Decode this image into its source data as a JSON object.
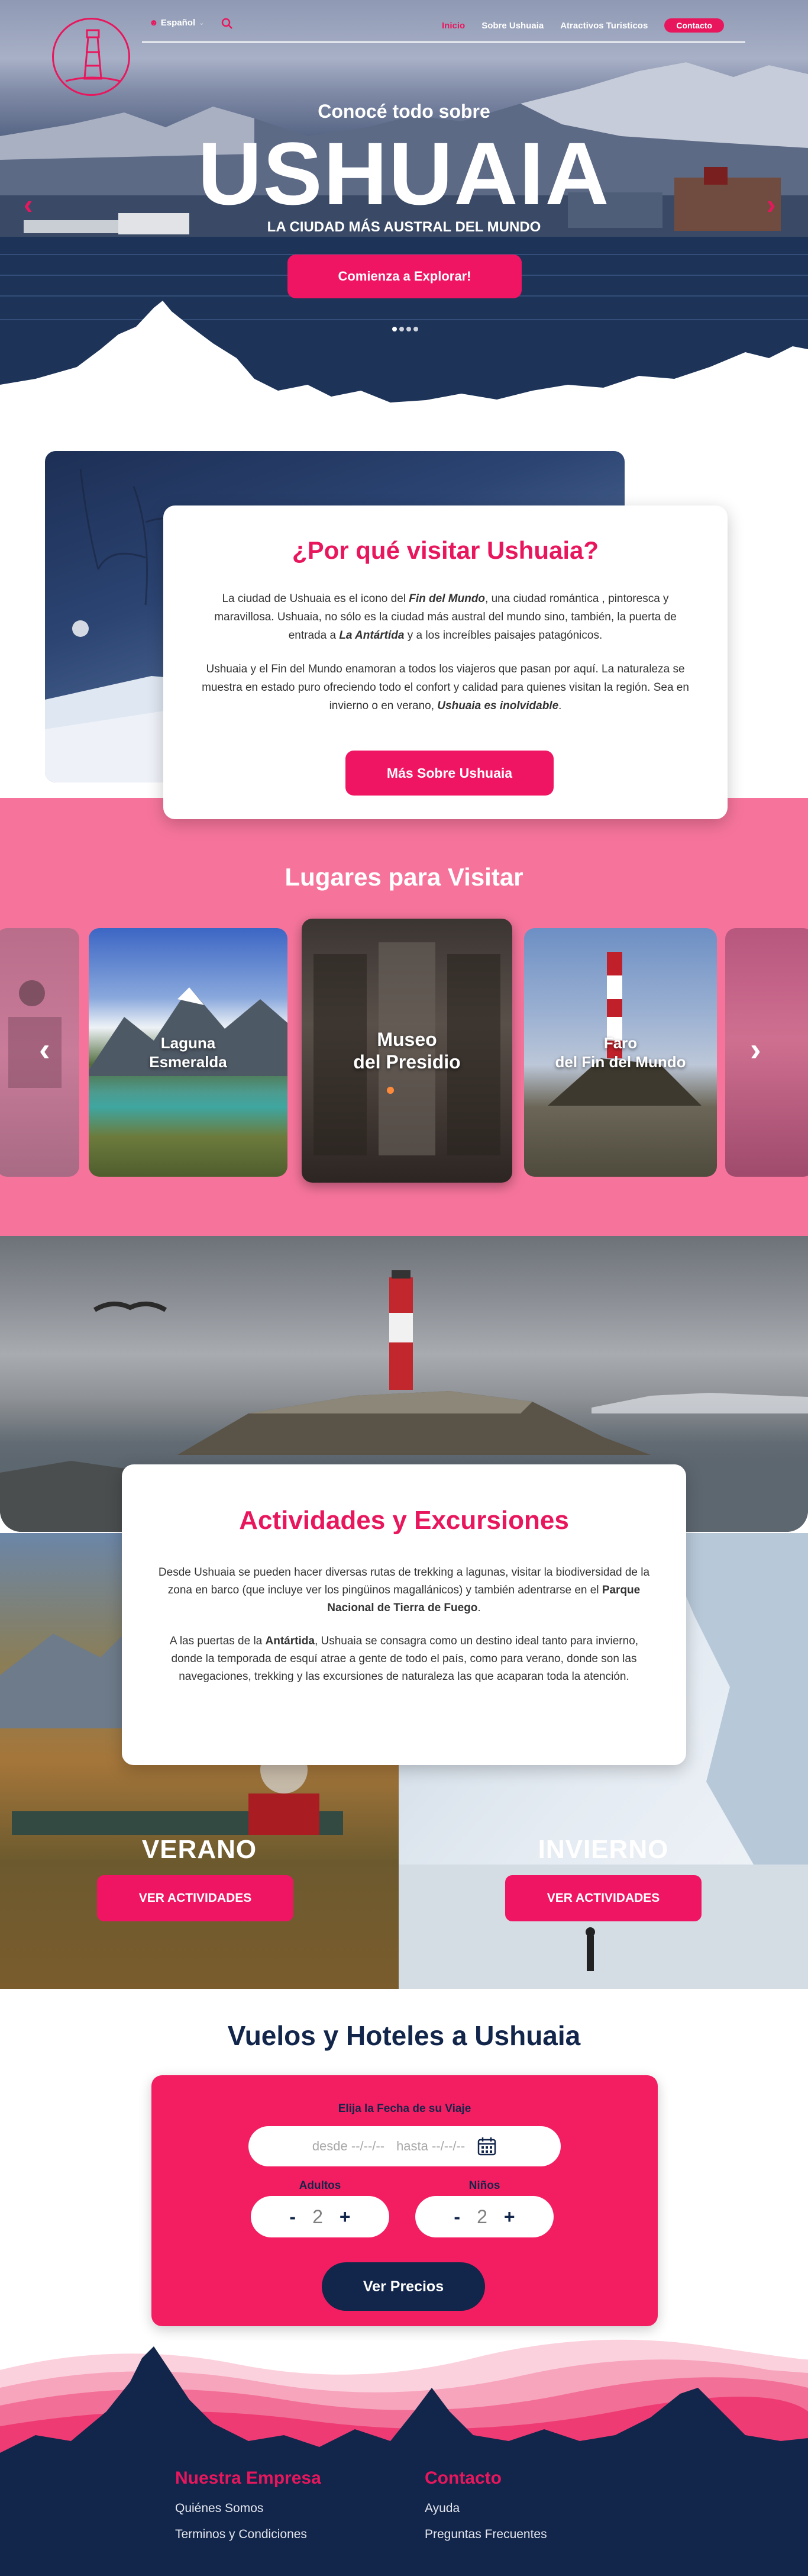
{
  "nav": {
    "language": "Español",
    "links": [
      "Inicio",
      "Sobre Ushuaia",
      "Atractivos Turisticos"
    ],
    "contact": "Contacto"
  },
  "hero": {
    "subtitle": "Conocé todo sobre",
    "title": "USHUAIA",
    "tagline": "LA CIUDAD MÁS AUSTRAL DEL MUNDO",
    "cta": "Comienza a Explorar!",
    "active_slide": 1,
    "slide_count": 4
  },
  "why": {
    "title": "¿Por qué visitar Ushuaia?",
    "p1_a": "La ciudad de Ushuaia es el icono del ",
    "p1_b": "Fin del Mundo",
    "p1_c": ", una ciudad romántica , pintoresca y maravillosa. Ushuaia, no sólo es la ciudad más austral del mundo sino, también, la puerta de entrada a ",
    "p1_d": "La Antártida",
    "p1_e": " y a los increíbles paisajes patagónicos.",
    "p2_a": "Ushuaia y el Fin del Mundo enamoran a todos los viajeros que pasan por aquí. La naturaleza se muestra en estado puro ofreciendo todo el confort y calidad para quienes visitan la región. Sea en invierno o en verano, ",
    "p2_b": "Ushuaia es inolvidable",
    "p2_c": ".",
    "button": "Más Sobre Ushuaia"
  },
  "places": {
    "title": "Lugares para Visitar",
    "items": [
      {
        "line1": "Laguna",
        "line2": "Esmeralda"
      },
      {
        "line1": "Museo",
        "line2": "del Presidio"
      },
      {
        "line1": "Faro",
        "line2": "del Fin del Mundo"
      }
    ]
  },
  "activities": {
    "title": "Actividades y Excursiones",
    "p1_a": "Desde Ushuaia se pueden hacer diversas rutas de trekking a lagunas, visitar la biodiversidad de la zona en barco (que incluye ver los pingüinos magallánicos) y también adentrarse en el ",
    "p1_b": "Parque Nacional de Tierra de Fuego",
    "p1_c": ".",
    "p2_a": "A las puertas de la ",
    "p2_b": "Antártida",
    "p2_c": ", Ushuaia se consagra como un destino ideal tanto para invierno, donde la temporada de esquí atrae a gente de todo el país, como para verano, donde son las navegaciones, trekking y las excursiones de naturaleza las que acaparan toda la atención.",
    "summer": "VERANO",
    "winter": "INVIERNO",
    "button": "VER ACTIVIDADES"
  },
  "flights": {
    "title": "Vuelos y Hoteles a Ushuaia",
    "date_label": "Elija la Fecha de su Viaje",
    "from_placeholder": "desde --/--/--",
    "to_placeholder": "hasta --/--/--",
    "adults_label": "Adultos",
    "children_label": "Niños",
    "adults": 2,
    "children": 2,
    "minus": "-",
    "plus": "+",
    "button": "Ver Precios"
  },
  "footer": {
    "company_title": "Nuestra Empresa",
    "company_links": [
      "Quiénes Somos",
      "Terminos y Condiciones"
    ],
    "contact_title": "Contacto",
    "contact_links": [
      "Ayuda",
      "Preguntas Frecuentes"
    ]
  },
  "colors": {
    "accent": "#e8175d",
    "pink_band": "#f6749c",
    "navy": "#12254a"
  }
}
